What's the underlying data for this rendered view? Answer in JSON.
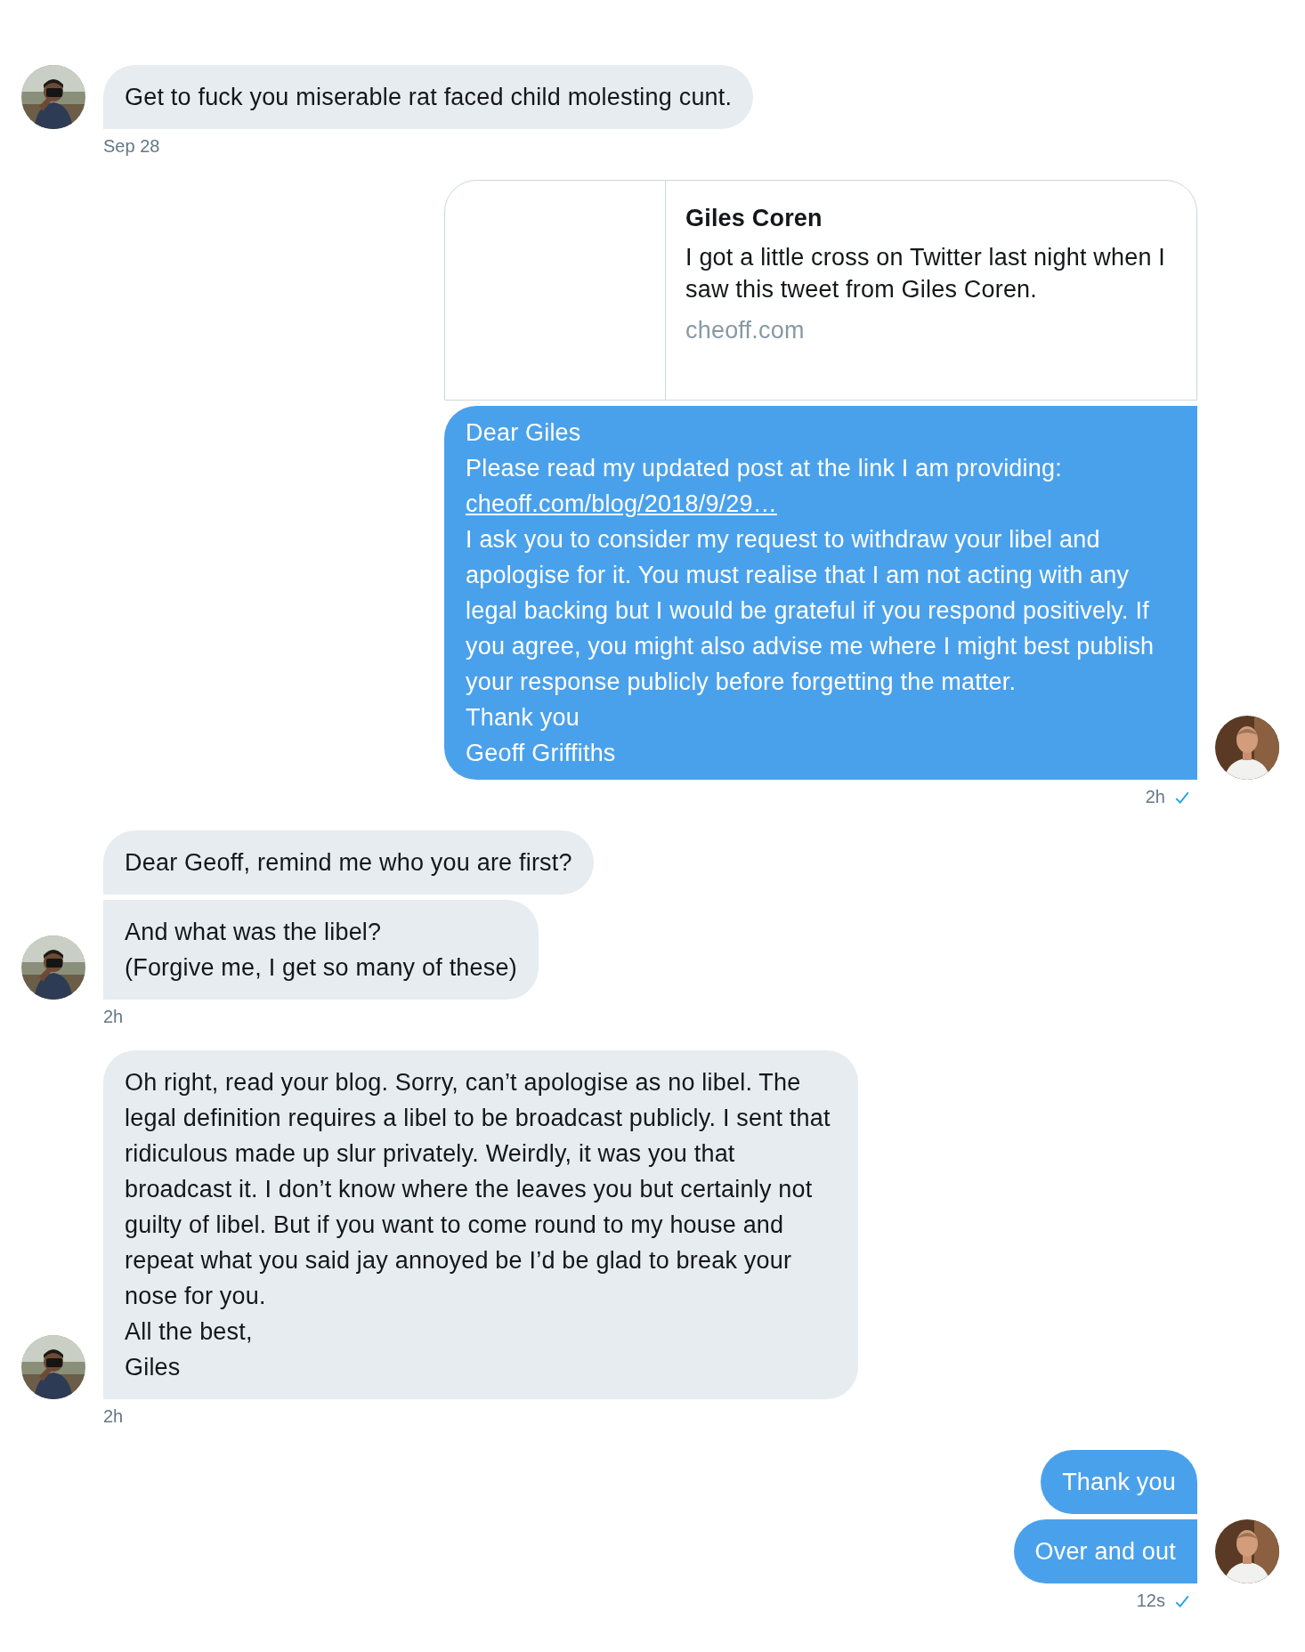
{
  "conversation": [
    {
      "kind": "incoming",
      "items": [
        {
          "kind": "text",
          "lines": [
            {
              "kind": "text",
              "text": "Get to fuck you miserable rat faced child molesting cunt."
            }
          ]
        }
      ],
      "time": "Sep 28"
    },
    {
      "kind": "outgoing",
      "items": [
        {
          "kind": "card",
          "title": "Giles Coren",
          "description": "I got a little cross on Twitter last night when I saw this tweet from Giles Coren.",
          "domain": "cheoff.com"
        },
        {
          "kind": "text",
          "lines": [
            {
              "kind": "text",
              "text": "Dear Giles"
            },
            {
              "kind": "text",
              "text": "Please read my updated post at the link I am providing:"
            },
            {
              "kind": "link",
              "text": "cheoff.com/blog/2018/9/29…"
            },
            {
              "kind": "text",
              "text": "I ask you to consider my request to withdraw your libel and apologise for it. You must realise that I am not acting with any legal backing but I would be grateful if you respond positively. If you agree, you might also advise me where I might best publish your response publicly before forgetting the matter."
            },
            {
              "kind": "text",
              "text": "Thank you"
            },
            {
              "kind": "text",
              "text": "Geoff Griffiths"
            }
          ]
        }
      ],
      "time": "2h",
      "read": true
    },
    {
      "kind": "incoming",
      "items": [
        {
          "kind": "text",
          "lines": [
            {
              "kind": "text",
              "text": "Dear Geoff, remind me who you are first?"
            }
          ]
        },
        {
          "kind": "text",
          "lines": [
            {
              "kind": "text",
              "text": "And what was the libel?"
            },
            {
              "kind": "text",
              "text": "(Forgive me, I get so many of these)"
            }
          ]
        }
      ],
      "time": "2h"
    },
    {
      "kind": "incoming",
      "items": [
        {
          "kind": "text",
          "lines": [
            {
              "kind": "text",
              "text": "Oh right, read your blog. Sorry, can’t apologise as no libel. The legal definition requires a libel to be broadcast publicly. I sent that ridiculous made up slur privately. Weirdly, it was you that broadcast it. I don’t know where the leaves you but  certainly not guilty of libel. But if you want to come round to my house and repeat what you said jay annoyed be I’d be glad to break your nose for you."
            },
            {
              "kind": "text",
              "text": "All the best,"
            },
            {
              "kind": "text",
              "text": "Giles"
            }
          ]
        }
      ],
      "time": "2h"
    },
    {
      "kind": "outgoing",
      "items": [
        {
          "kind": "text",
          "lines": [
            {
              "kind": "text",
              "text": "Thank you"
            }
          ]
        },
        {
          "kind": "text",
          "lines": [
            {
              "kind": "text",
              "text": "Over and out"
            }
          ]
        }
      ],
      "time": "12s",
      "read": true
    }
  ]
}
